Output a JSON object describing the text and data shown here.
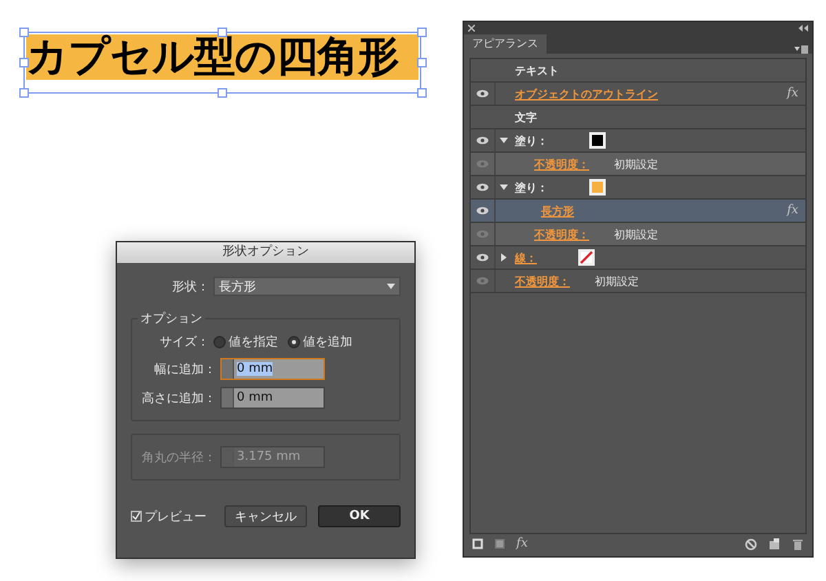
{
  "canvas": {
    "text": "カプセル型の四角形"
  },
  "dialog": {
    "title": "形状オプション",
    "shape": {
      "label": "形状：",
      "value": "長方形"
    },
    "options": {
      "title": "オプション",
      "size_label": "サイズ：",
      "size_options": [
        {
          "label": "値を指定",
          "selected": false
        },
        {
          "label": "値を追加",
          "selected": true
        }
      ],
      "fields": [
        {
          "label": "幅に追加：",
          "value": "0 mm",
          "focused": true
        },
        {
          "label": "高さに追加：",
          "value": "0 mm",
          "focused": false
        }
      ]
    },
    "corner": {
      "label": "角丸の半径：",
      "value": "3.175 mm",
      "disabled": true
    },
    "preview": {
      "label": "プレビュー",
      "checked": true
    },
    "buttons": [
      {
        "label": "キャンセル",
        "default": false
      },
      {
        "label": "OK",
        "default": true
      }
    ]
  },
  "panel": {
    "tab": "アピアランス",
    "rows": [
      {
        "kind": "object",
        "label": "テキスト",
        "selected": false
      },
      {
        "kind": "effect",
        "label": "オブジェクトのアウトライン",
        "fx": "fx",
        "selected": false
      },
      {
        "kind": "object",
        "label": "文字",
        "selected": false
      },
      {
        "kind": "fill",
        "label": "塗り：",
        "color": "#000000",
        "expanded": true,
        "selected": false,
        "children": [
          {
            "kind": "opacity",
            "label": "不透明度：",
            "value": "初期設定",
            "selected": false
          }
        ]
      },
      {
        "kind": "fill",
        "label": "塗り：",
        "color": "#f5b040",
        "expanded": true,
        "selected": false,
        "children": [
          {
            "kind": "effect",
            "label": "長方形",
            "fx": "fx",
            "selected": true
          },
          {
            "kind": "opacity",
            "label": "不透明度：",
            "value": "初期設定",
            "selected": false
          }
        ]
      },
      {
        "kind": "stroke",
        "label": "線：",
        "expanded": false,
        "selected": false
      },
      {
        "kind": "opacity",
        "label": "不透明度：",
        "value": "初期設定",
        "selected": false
      }
    ],
    "toolbar_fx": "fx"
  }
}
